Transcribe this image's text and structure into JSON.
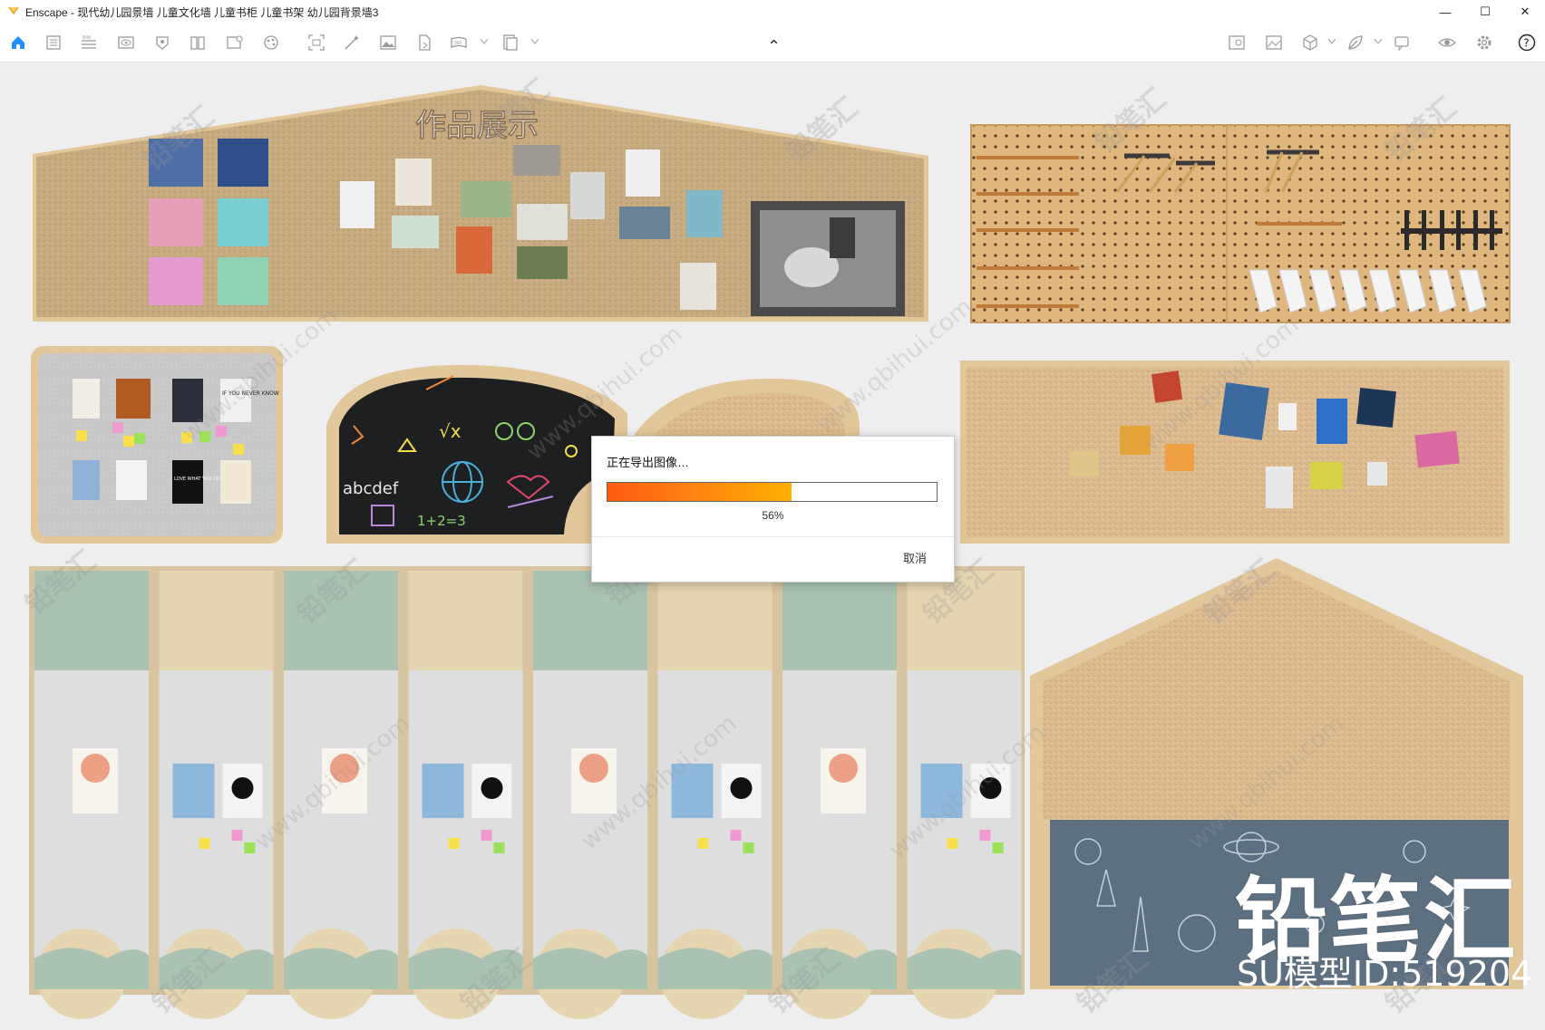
{
  "window": {
    "title": "Enscape - 现代幼儿园景墙 儿童文化墙 儿童书柜 儿童书架 幼儿园背景墙3",
    "minimize_glyph": "—",
    "maximize_glyph": "☐",
    "close_glyph": "✕"
  },
  "toolbar": {
    "collapse_glyph": "⌃",
    "left_icons": [
      "home-icon",
      "document-icon",
      "bim-icon",
      "view-icon",
      "asset-library-icon",
      "books-icon",
      "views-manager-icon",
      "material-icon",
      "capture-icon",
      "magic-icon",
      "image-icon",
      "export-icon",
      "panorama-icon",
      "batch-export-icon"
    ],
    "right_icons": [
      "image-compare-icon",
      "gallery-icon",
      "cube-icon",
      "leaf-icon",
      "chat-icon",
      "eye-icon",
      "settings-icon",
      "help-icon"
    ]
  },
  "scene": {
    "artwork_wall_title": "作品展示",
    "blackboard_formula": "√x",
    "blackboard_letters": "abcdef",
    "blackboard_math": "1+2=3",
    "poster_love": "LOVE WHAT YOU DO",
    "poster_if": "IF YOU NEVER KNOW"
  },
  "overlay": {
    "brand_mark": "铅笔汇",
    "model_id": "SU模型ID:519204",
    "watermark_text": "铅笔汇",
    "watermark_url": "www.qbihui.com"
  },
  "dialog": {
    "title": "正在导出图像…",
    "progress_percent": 56,
    "progress_label": "56%",
    "cancel_label": "取消"
  },
  "colors": {
    "accent_home": "#1e90ff",
    "progress_start": "#ff5a14",
    "progress_end": "#ffb000",
    "cork": "#d8b488",
    "wood_frame": "#e2c79a",
    "sage": "#a9c2b2",
    "beige": "#e5d5b0",
    "wallpaper_blue": "#5f7283"
  }
}
